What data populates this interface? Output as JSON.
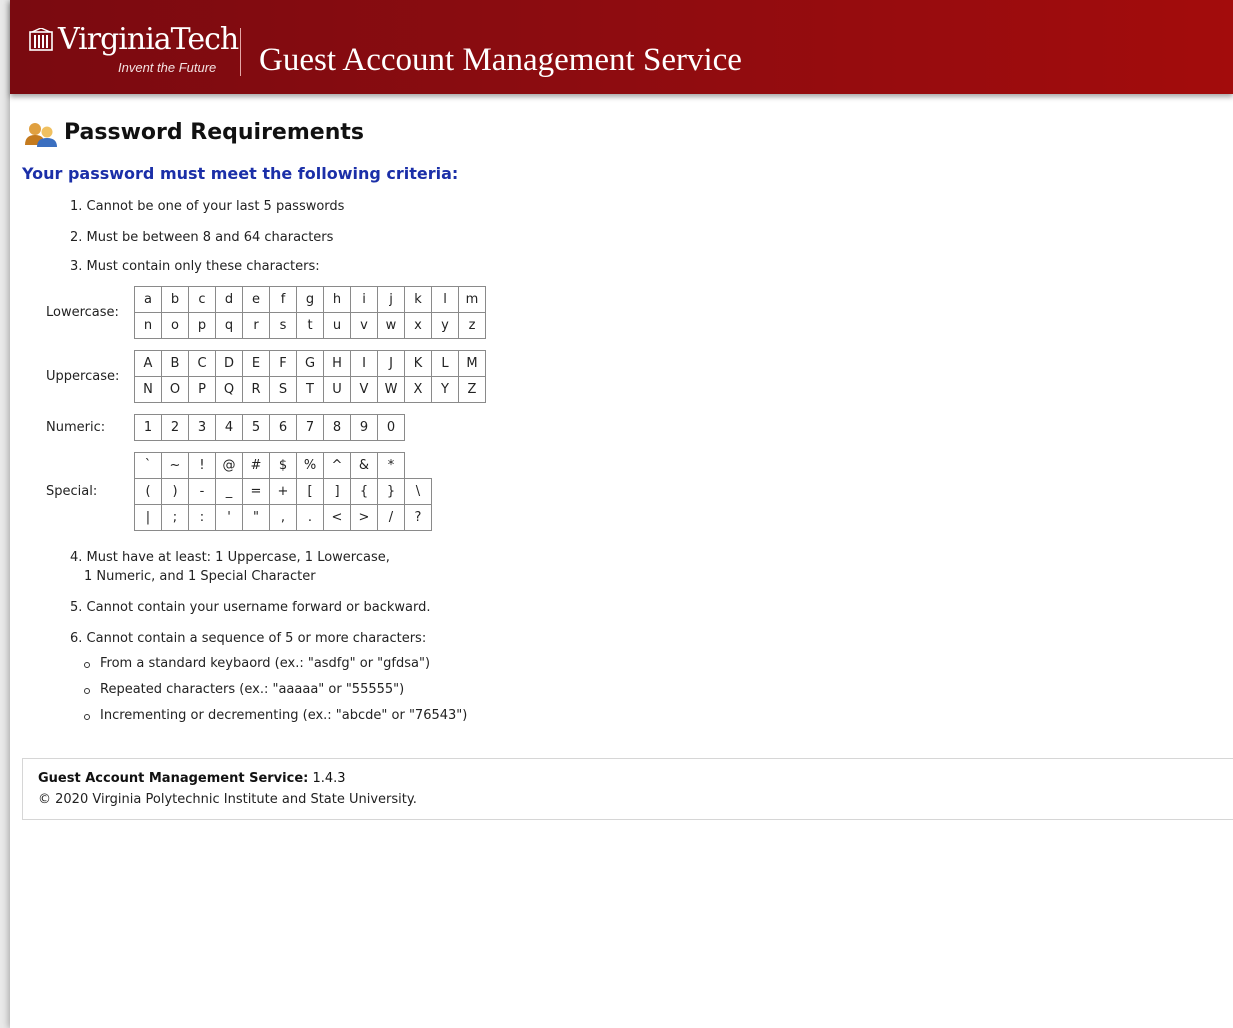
{
  "header": {
    "logo_text": "VirginiaTech",
    "tagline": "Invent the Future",
    "app_title": "Guest Account Management Service"
  },
  "page": {
    "title": "Password Requirements",
    "criteria_heading": "Your password must meet the following criteria:"
  },
  "rules": {
    "r1": "1. Cannot be one of your last 5 passwords",
    "r2": "2. Must be between 8 and 64 characters",
    "r3": "3. Must contain only these characters:",
    "r4_line1": "4. Must have at least: 1 Uppercase, 1 Lowercase,",
    "r4_line2": "1 Numeric, and 1 Special Character",
    "r5": "5. Cannot contain your username forward or backward.",
    "r6": "6. Cannot contain a sequence of 5 or more characters:",
    "r6_sub": [
      "From a standard keybaord (ex.: \"asdfg\" or \"gfdsa\")",
      "Repeated characters (ex.: \"aaaaa\" or \"55555\")",
      "Incrementing or decrementing (ex.: \"abcde\" or \"76543\")"
    ]
  },
  "charsets": {
    "lowercase_label": "Lowercase:",
    "lowercase": [
      [
        "a",
        "b",
        "c",
        "d",
        "e",
        "f",
        "g",
        "h",
        "i",
        "j",
        "k",
        "l",
        "m"
      ],
      [
        "n",
        "o",
        "p",
        "q",
        "r",
        "s",
        "t",
        "u",
        "v",
        "w",
        "x",
        "y",
        "z"
      ]
    ],
    "uppercase_label": "Uppercase:",
    "uppercase": [
      [
        "A",
        "B",
        "C",
        "D",
        "E",
        "F",
        "G",
        "H",
        "I",
        "J",
        "K",
        "L",
        "M"
      ],
      [
        "N",
        "O",
        "P",
        "Q",
        "R",
        "S",
        "T",
        "U",
        "V",
        "W",
        "X",
        "Y",
        "Z"
      ]
    ],
    "numeric_label": "Numeric:",
    "numeric": [
      [
        "1",
        "2",
        "3",
        "4",
        "5",
        "6",
        "7",
        "8",
        "9",
        "0"
      ]
    ],
    "special_label": "Special:",
    "special": [
      [
        "`",
        "~",
        "!",
        "@",
        "#",
        "$",
        "%",
        "^",
        "&",
        "*"
      ],
      [
        "(",
        ")",
        "-",
        "_",
        "=",
        "+",
        "[",
        "]",
        "{",
        "}",
        "\\"
      ],
      [
        "|",
        ";",
        ":",
        "'",
        "\"",
        ",",
        ".",
        "<",
        ">",
        "/",
        "?"
      ]
    ]
  },
  "footer": {
    "name_label": "Guest Account Management Service:",
    "version": "1.4.3",
    "copyright": "© 2020 Virginia Polytechnic Institute and State University."
  },
  "colors": {
    "header_dark": "#7a0a10",
    "header_light": "#a30c0c",
    "heading_blue": "#1b2fa8"
  }
}
